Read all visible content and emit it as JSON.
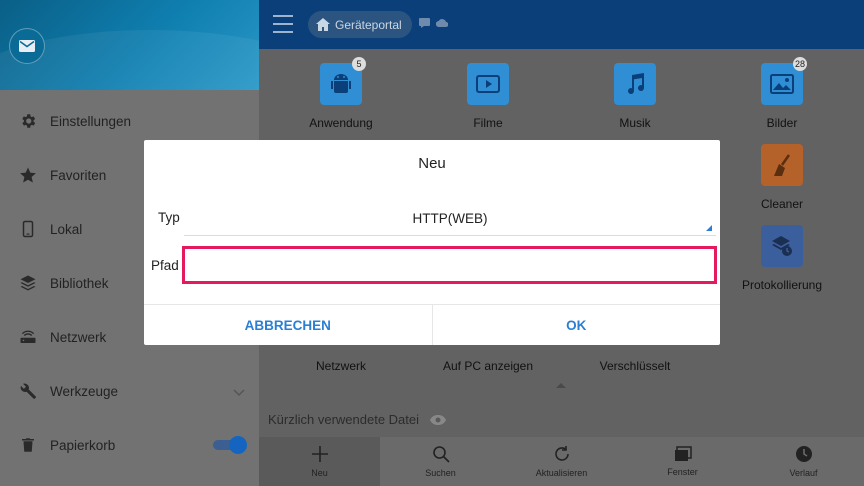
{
  "colors": {
    "accent": "#2a7fd4",
    "highlight": "#e5195e",
    "topbar": "#0b3f7a",
    "tile_blue": "#2f8ed4",
    "tile_cleaner": "#b5612a",
    "tile_log": "#3a5f9c"
  },
  "sidebar": {
    "mail_icon": "mail-icon",
    "items": [
      {
        "label": "Einstellungen",
        "icon": "gear-icon"
      },
      {
        "label": "Favoriten",
        "icon": "star-icon"
      },
      {
        "label": "Lokal",
        "icon": "phone-icon"
      },
      {
        "label": "Bibliothek",
        "icon": "layers-icon"
      },
      {
        "label": "Netzwerk",
        "icon": "router-icon"
      },
      {
        "label": "Werkzeuge",
        "icon": "wrench-icon"
      },
      {
        "label": "Papierkorb",
        "icon": "trash-icon"
      }
    ]
  },
  "topbar": {
    "breadcrumb": "Geräteportal"
  },
  "grid": [
    {
      "label": "Anwendung",
      "icon": "android-icon",
      "badge": "5"
    },
    {
      "label": "Filme",
      "icon": "film-icon",
      "badge": ""
    },
    {
      "label": "Musik",
      "icon": "music-icon",
      "badge": ""
    },
    {
      "label": "Bilder",
      "icon": "image-icon",
      "badge": "28"
    },
    {
      "label": "Cleaner",
      "icon": "broom-icon",
      "badge": ""
    },
    {
      "label": "Protokollierung",
      "icon": "log-icon",
      "badge": ""
    },
    {
      "label": "Netzwerk",
      "icon": "network-icon",
      "badge": ""
    },
    {
      "label": "Auf PC anzeigen",
      "icon": "pc-icon",
      "badge": ""
    },
    {
      "label": "Verschlüsselt",
      "icon": "lock-icon",
      "badge": ""
    }
  ],
  "recent": {
    "label": "Kürzlich verwendete Datei"
  },
  "bottombar": [
    {
      "label": "Neu",
      "icon": "plus-icon"
    },
    {
      "label": "Suchen",
      "icon": "search-icon"
    },
    {
      "label": "Aktualisieren",
      "icon": "refresh-icon"
    },
    {
      "label": "Fenster",
      "icon": "windows-icon"
    },
    {
      "label": "Verlauf",
      "icon": "clock-icon"
    }
  ],
  "dialog": {
    "title": "Neu",
    "typ_label": "Typ",
    "typ_value": "HTTP(WEB)",
    "pfad_label": "Pfad",
    "pfad_value": "",
    "cancel": "ABBRECHEN",
    "ok": "OK"
  }
}
